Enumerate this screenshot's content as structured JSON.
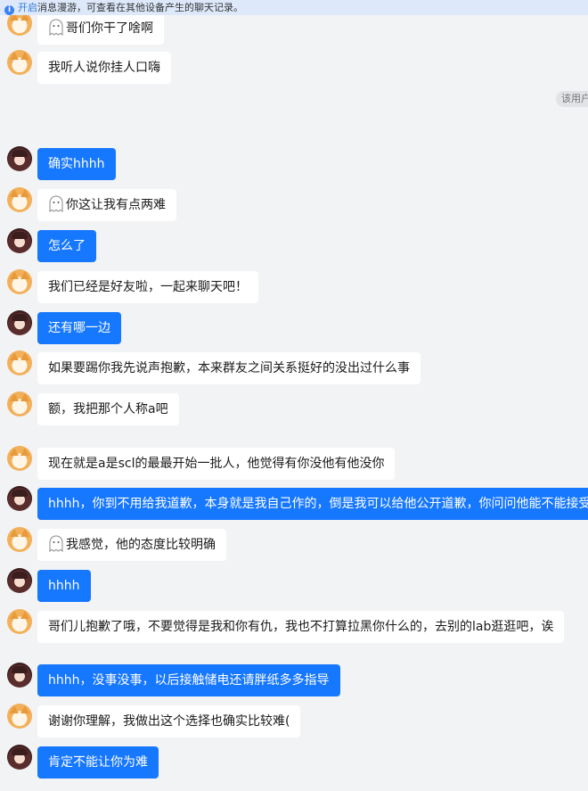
{
  "banner": {
    "link": "开启",
    "text": "消息漫游，可查看在其他设备产生的聊天记录。"
  },
  "system_pill": "该用户",
  "messages": [
    {
      "side": "other",
      "ghost": true,
      "text": "哥们你干了啥啊"
    },
    {
      "side": "other",
      "ghost": false,
      "text": "我听人说你挂人口嗨"
    },
    {
      "side": "me",
      "ghost": false,
      "text": "确实hhhh"
    },
    {
      "side": "other",
      "ghost": true,
      "text": "你这让我有点两难"
    },
    {
      "side": "me",
      "ghost": false,
      "text": "怎么了"
    },
    {
      "side": "other",
      "ghost": false,
      "text": "我们已经是好友啦，一起来聊天吧！"
    },
    {
      "side": "me",
      "ghost": false,
      "text": "还有哪一边"
    },
    {
      "side": "other",
      "ghost": false,
      "text": "如果要踢你我先说声抱歉，本来群友之间关系挺好的没出过什么事"
    },
    {
      "side": "other",
      "ghost": false,
      "text": "额，我把那个人称a吧"
    },
    {
      "side": "other",
      "ghost": false,
      "text": "现在就是a是scl的最最开始一批人，他觉得有你没他有他没你"
    },
    {
      "side": "me",
      "ghost": false,
      "text": "hhhh，你到不用给我道歉，本身就是我自己作的，倒是我可以给他公开道歉，你问问他能不能接受"
    },
    {
      "side": "other",
      "ghost": true,
      "text": "我感觉，他的态度比较明确"
    },
    {
      "side": "me",
      "ghost": false,
      "text": "hhhh"
    },
    {
      "side": "other",
      "ghost": false,
      "text": "哥们儿抱歉了哦，不要觉得是我和你有仇，我也不打算拉黑你什么的，去别的lab逛逛吧，诶"
    },
    {
      "side": "me",
      "ghost": false,
      "text": "hhhh，没事没事，以后接触储电还请胖纸多多指导"
    },
    {
      "side": "other",
      "ghost": false,
      "text": "谢谢你理解，我做出这个选择也确实比较难("
    },
    {
      "side": "me",
      "ghost": false,
      "text": "肯定不能让你为难"
    }
  ]
}
